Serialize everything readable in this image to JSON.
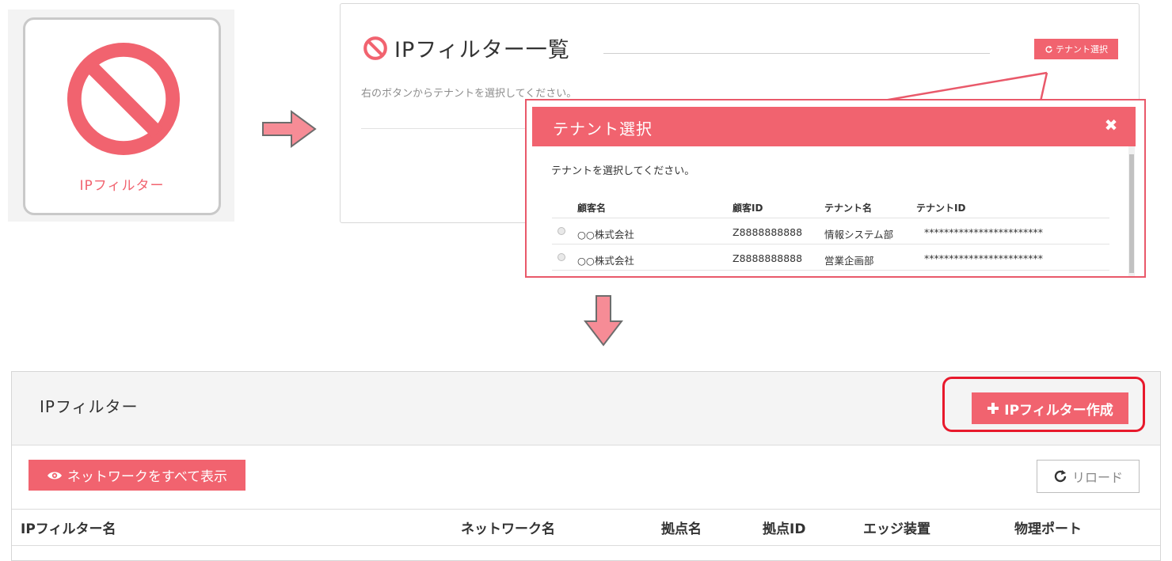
{
  "tile": {
    "label": "IPフィルター",
    "icon": "prohibited-icon"
  },
  "list_panel": {
    "title": "IPフィルター一覧",
    "tenant_button_label": "テナント選択",
    "hint": "右のボタンからテナントを選択してください。"
  },
  "modal": {
    "title": "テナント選択",
    "close_label": "✖",
    "prompt": "テナントを選択してください。",
    "columns": [
      "顧客名",
      "顧客ID",
      "テナント名",
      "テナントID"
    ],
    "rows": [
      {
        "customer": "○○株式会社",
        "customer_id": "Z8888888888",
        "tenant": "情報システム部",
        "tenant_id": "************************"
      },
      {
        "customer": "○○株式会社",
        "customer_id": "Z8888888888",
        "tenant": "営業企画部",
        "tenant_id": "************************"
      }
    ]
  },
  "bottom_panel": {
    "title": "IPフィルター",
    "create_button": "IPフィルター作成",
    "show_all_button": "ネットワークをすべて表示",
    "reload_button": "リロード",
    "columns": [
      "IPフィルター名",
      "ネットワーク名",
      "拠点名",
      "拠点ID",
      "エッジ装置",
      "物理ポート"
    ]
  },
  "colors": {
    "accent": "#f1636f",
    "highlight": "#e8192c"
  }
}
